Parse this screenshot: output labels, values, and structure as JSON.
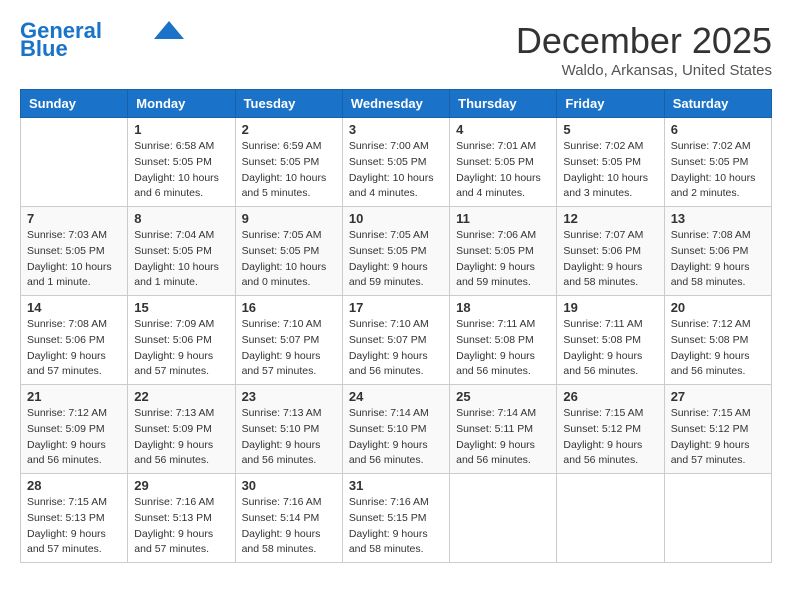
{
  "header": {
    "logo_line1": "General",
    "logo_line2": "Blue",
    "month": "December 2025",
    "location": "Waldo, Arkansas, United States"
  },
  "days_of_week": [
    "Sunday",
    "Monday",
    "Tuesday",
    "Wednesday",
    "Thursday",
    "Friday",
    "Saturday"
  ],
  "weeks": [
    [
      {
        "day": "",
        "info": ""
      },
      {
        "day": "1",
        "info": "Sunrise: 6:58 AM\nSunset: 5:05 PM\nDaylight: 10 hours\nand 6 minutes."
      },
      {
        "day": "2",
        "info": "Sunrise: 6:59 AM\nSunset: 5:05 PM\nDaylight: 10 hours\nand 5 minutes."
      },
      {
        "day": "3",
        "info": "Sunrise: 7:00 AM\nSunset: 5:05 PM\nDaylight: 10 hours\nand 4 minutes."
      },
      {
        "day": "4",
        "info": "Sunrise: 7:01 AM\nSunset: 5:05 PM\nDaylight: 10 hours\nand 4 minutes."
      },
      {
        "day": "5",
        "info": "Sunrise: 7:02 AM\nSunset: 5:05 PM\nDaylight: 10 hours\nand 3 minutes."
      },
      {
        "day": "6",
        "info": "Sunrise: 7:02 AM\nSunset: 5:05 PM\nDaylight: 10 hours\nand 2 minutes."
      }
    ],
    [
      {
        "day": "7",
        "info": "Sunrise: 7:03 AM\nSunset: 5:05 PM\nDaylight: 10 hours\nand 1 minute."
      },
      {
        "day": "8",
        "info": "Sunrise: 7:04 AM\nSunset: 5:05 PM\nDaylight: 10 hours\nand 1 minute."
      },
      {
        "day": "9",
        "info": "Sunrise: 7:05 AM\nSunset: 5:05 PM\nDaylight: 10 hours\nand 0 minutes."
      },
      {
        "day": "10",
        "info": "Sunrise: 7:05 AM\nSunset: 5:05 PM\nDaylight: 9 hours\nand 59 minutes."
      },
      {
        "day": "11",
        "info": "Sunrise: 7:06 AM\nSunset: 5:05 PM\nDaylight: 9 hours\nand 59 minutes."
      },
      {
        "day": "12",
        "info": "Sunrise: 7:07 AM\nSunset: 5:06 PM\nDaylight: 9 hours\nand 58 minutes."
      },
      {
        "day": "13",
        "info": "Sunrise: 7:08 AM\nSunset: 5:06 PM\nDaylight: 9 hours\nand 58 minutes."
      }
    ],
    [
      {
        "day": "14",
        "info": "Sunrise: 7:08 AM\nSunset: 5:06 PM\nDaylight: 9 hours\nand 57 minutes."
      },
      {
        "day": "15",
        "info": "Sunrise: 7:09 AM\nSunset: 5:06 PM\nDaylight: 9 hours\nand 57 minutes."
      },
      {
        "day": "16",
        "info": "Sunrise: 7:10 AM\nSunset: 5:07 PM\nDaylight: 9 hours\nand 57 minutes."
      },
      {
        "day": "17",
        "info": "Sunrise: 7:10 AM\nSunset: 5:07 PM\nDaylight: 9 hours\nand 56 minutes."
      },
      {
        "day": "18",
        "info": "Sunrise: 7:11 AM\nSunset: 5:08 PM\nDaylight: 9 hours\nand 56 minutes."
      },
      {
        "day": "19",
        "info": "Sunrise: 7:11 AM\nSunset: 5:08 PM\nDaylight: 9 hours\nand 56 minutes."
      },
      {
        "day": "20",
        "info": "Sunrise: 7:12 AM\nSunset: 5:08 PM\nDaylight: 9 hours\nand 56 minutes."
      }
    ],
    [
      {
        "day": "21",
        "info": "Sunrise: 7:12 AM\nSunset: 5:09 PM\nDaylight: 9 hours\nand 56 minutes."
      },
      {
        "day": "22",
        "info": "Sunrise: 7:13 AM\nSunset: 5:09 PM\nDaylight: 9 hours\nand 56 minutes."
      },
      {
        "day": "23",
        "info": "Sunrise: 7:13 AM\nSunset: 5:10 PM\nDaylight: 9 hours\nand 56 minutes."
      },
      {
        "day": "24",
        "info": "Sunrise: 7:14 AM\nSunset: 5:10 PM\nDaylight: 9 hours\nand 56 minutes."
      },
      {
        "day": "25",
        "info": "Sunrise: 7:14 AM\nSunset: 5:11 PM\nDaylight: 9 hours\nand 56 minutes."
      },
      {
        "day": "26",
        "info": "Sunrise: 7:15 AM\nSunset: 5:12 PM\nDaylight: 9 hours\nand 56 minutes."
      },
      {
        "day": "27",
        "info": "Sunrise: 7:15 AM\nSunset: 5:12 PM\nDaylight: 9 hours\nand 57 minutes."
      }
    ],
    [
      {
        "day": "28",
        "info": "Sunrise: 7:15 AM\nSunset: 5:13 PM\nDaylight: 9 hours\nand 57 minutes."
      },
      {
        "day": "29",
        "info": "Sunrise: 7:16 AM\nSunset: 5:13 PM\nDaylight: 9 hours\nand 57 minutes."
      },
      {
        "day": "30",
        "info": "Sunrise: 7:16 AM\nSunset: 5:14 PM\nDaylight: 9 hours\nand 58 minutes."
      },
      {
        "day": "31",
        "info": "Sunrise: 7:16 AM\nSunset: 5:15 PM\nDaylight: 9 hours\nand 58 minutes."
      },
      {
        "day": "",
        "info": ""
      },
      {
        "day": "",
        "info": ""
      },
      {
        "day": "",
        "info": ""
      }
    ]
  ]
}
